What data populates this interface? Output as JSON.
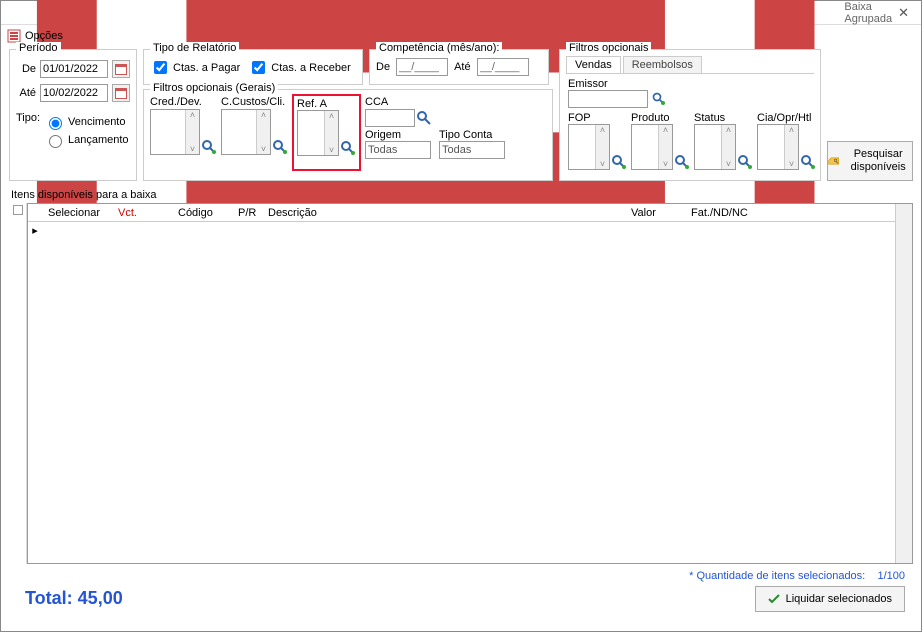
{
  "window": {
    "title": "Baixa Agrupada"
  },
  "menu": {
    "opcoes": "Opções"
  },
  "periodo": {
    "legend": "Período",
    "de_label": "De",
    "de_value": "01/01/2022",
    "ate_label": "Até",
    "ate_value": "10/02/2022",
    "tipo_label": "Tipo:",
    "vencimento": "Vencimento",
    "lancamento": "Lançamento"
  },
  "tipo_relatorio": {
    "legend": "Tipo de Relatório",
    "ctas_pagar": "Ctas. a Pagar",
    "ctas_receber": "Ctas. a Receber"
  },
  "competencia": {
    "legend": "Competência (mês/ano):",
    "de_label": "De",
    "de_value": "__/____",
    "ate_label": "Até",
    "ate_value": "__/____"
  },
  "filtros_gerais": {
    "legend": "Filtros opcionais (Gerais)",
    "cred_dev": "Cred./Dev.",
    "ccustos": "C.Custos/Cli.",
    "ref_a": "Ref. A",
    "cca": "CCA",
    "origem": "Origem",
    "origem_value": "Todas",
    "tipo_conta": "Tipo Conta",
    "tipo_conta_value": "Todas"
  },
  "filtros_opc": {
    "legend": "Filtros opcionais",
    "tab_vendas": "Vendas",
    "tab_reembolsos": "Reembolsos",
    "emissor": "Emissor",
    "fop": "FOP",
    "produto": "Produto",
    "status": "Status",
    "cia": "Cia/Opr/Htl"
  },
  "pesquisar": {
    "label": "Pesquisar disponíveis"
  },
  "itens": {
    "title": "Itens disponíveis para a baixa",
    "col_selecionar": "Selecionar",
    "col_vct": "Vct.",
    "col_codigo": "Código",
    "col_pr": "P/R",
    "col_descricao": "Descrição",
    "col_valor": "Valor",
    "col_fat": "Fat./ND/NC"
  },
  "footer": {
    "qtd_label": "* Quantidade de itens selecionados:",
    "qtd_value": "1/100",
    "total_label": "Total:",
    "total_value": "45,00",
    "liquidar": "Liquidar selecionados"
  }
}
